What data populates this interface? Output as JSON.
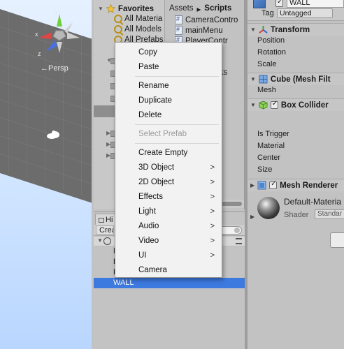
{
  "scene": {
    "persp_label": "←Persp",
    "gizmo_axes": {
      "y": "y",
      "x": "x",
      "z": "z"
    }
  },
  "project": {
    "favorites_label": "Favorites",
    "favorites": [
      "All Materia",
      "All Models",
      "All Prefabs"
    ],
    "breadcrumb": {
      "root": "Assets",
      "sep": "▸",
      "current": "Scripts"
    },
    "scripts": [
      "CameraContro",
      "mainMenu",
      "PlayerContr"
    ],
    "partial_items": [
      "e",
      "cks",
      "m"
    ]
  },
  "hierarchy": {
    "tab_label": "Hi",
    "create_label": "Crea",
    "children": [
      "N",
      "D",
      "P",
      "F"
    ],
    "selected_item": "WALL"
  },
  "inspector": {
    "object_name": "WALL",
    "tag_label": "Tag",
    "tag_value": "Untagged",
    "transform": {
      "title": "Transform",
      "props": [
        "Position",
        "Rotation",
        "Scale"
      ]
    },
    "mesh_filter": {
      "title": "Cube (Mesh Filt",
      "props": [
        "Mesh"
      ]
    },
    "box_collider": {
      "title": "Box Collider",
      "props": [
        "Is Trigger",
        "Material",
        "Center",
        "Size"
      ]
    },
    "mesh_renderer": {
      "title": "Mesh Renderer"
    },
    "material": {
      "name": "Default-Materia",
      "shader_label": "Shader",
      "shader_value": "Standar"
    }
  },
  "context_menu": {
    "items": [
      {
        "label": "Copy",
        "enabled": true,
        "submenu": false
      },
      {
        "label": "Paste",
        "enabled": true,
        "submenu": false
      },
      {
        "label": "Rename",
        "enabled": true,
        "submenu": false
      },
      {
        "label": "Duplicate",
        "enabled": true,
        "submenu": false
      },
      {
        "label": "Delete",
        "enabled": true,
        "submenu": false
      },
      {
        "label": "Select Prefab",
        "enabled": false,
        "submenu": false
      },
      {
        "label": "Create Empty",
        "enabled": true,
        "submenu": false
      },
      {
        "label": "3D Object",
        "enabled": true,
        "submenu": true
      },
      {
        "label": "2D Object",
        "enabled": true,
        "submenu": true
      },
      {
        "label": "Effects",
        "enabled": true,
        "submenu": true
      },
      {
        "label": "Light",
        "enabled": true,
        "submenu": true
      },
      {
        "label": "Audio",
        "enabled": true,
        "submenu": true
      },
      {
        "label": "Video",
        "enabled": true,
        "submenu": true
      },
      {
        "label": "UI",
        "enabled": true,
        "submenu": true
      },
      {
        "label": "Camera",
        "enabled": true,
        "submenu": false
      }
    ],
    "submenu_arrow": ">"
  },
  "colors": {
    "selection": "#3d7ae0",
    "menu_bg": "#f2f2f2",
    "panel_bg": "#c2c2c2",
    "disabled_text": "#9b9b9b"
  },
  "icons": {
    "favorites": "star-icon",
    "saved_search": "search-icon",
    "script": "csharp-script-icon",
    "transform": "transform-icon",
    "mesh_filter": "mesh-filter-icon",
    "box_collider": "box-collider-icon",
    "mesh_renderer": "mesh-renderer-icon"
  }
}
